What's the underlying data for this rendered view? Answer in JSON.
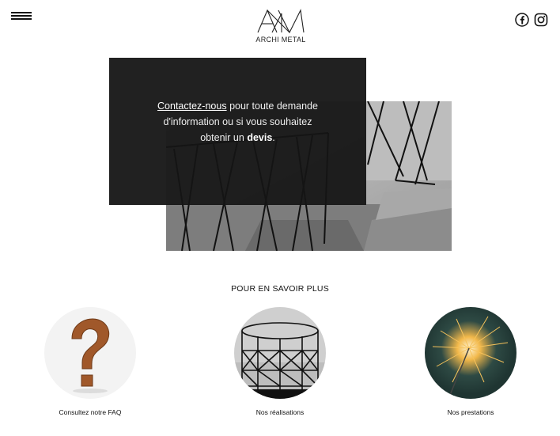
{
  "header": {
    "menu_icon": "hamburger-menu-icon",
    "logo_text": "ARCHI METAL",
    "social": [
      {
        "name": "facebook-icon"
      },
      {
        "name": "instagram-icon"
      }
    ]
  },
  "hero": {
    "link_text": "Contactez-nous",
    "text_part1": " pour toute demande",
    "text_part2": "d'information ou si vous souhaitez",
    "text_part3": "obtenir un ",
    "bold_text": "devis",
    "text_end": "."
  },
  "learn_more": {
    "title": "POUR EN SAVOIR PLUS",
    "cards": [
      {
        "label": "Consultez notre FAQ"
      },
      {
        "label": "Nos réalisations"
      },
      {
        "label": "Nos prestations"
      }
    ]
  },
  "colors": {
    "dark_panel": "#151515",
    "text": "#111111"
  }
}
